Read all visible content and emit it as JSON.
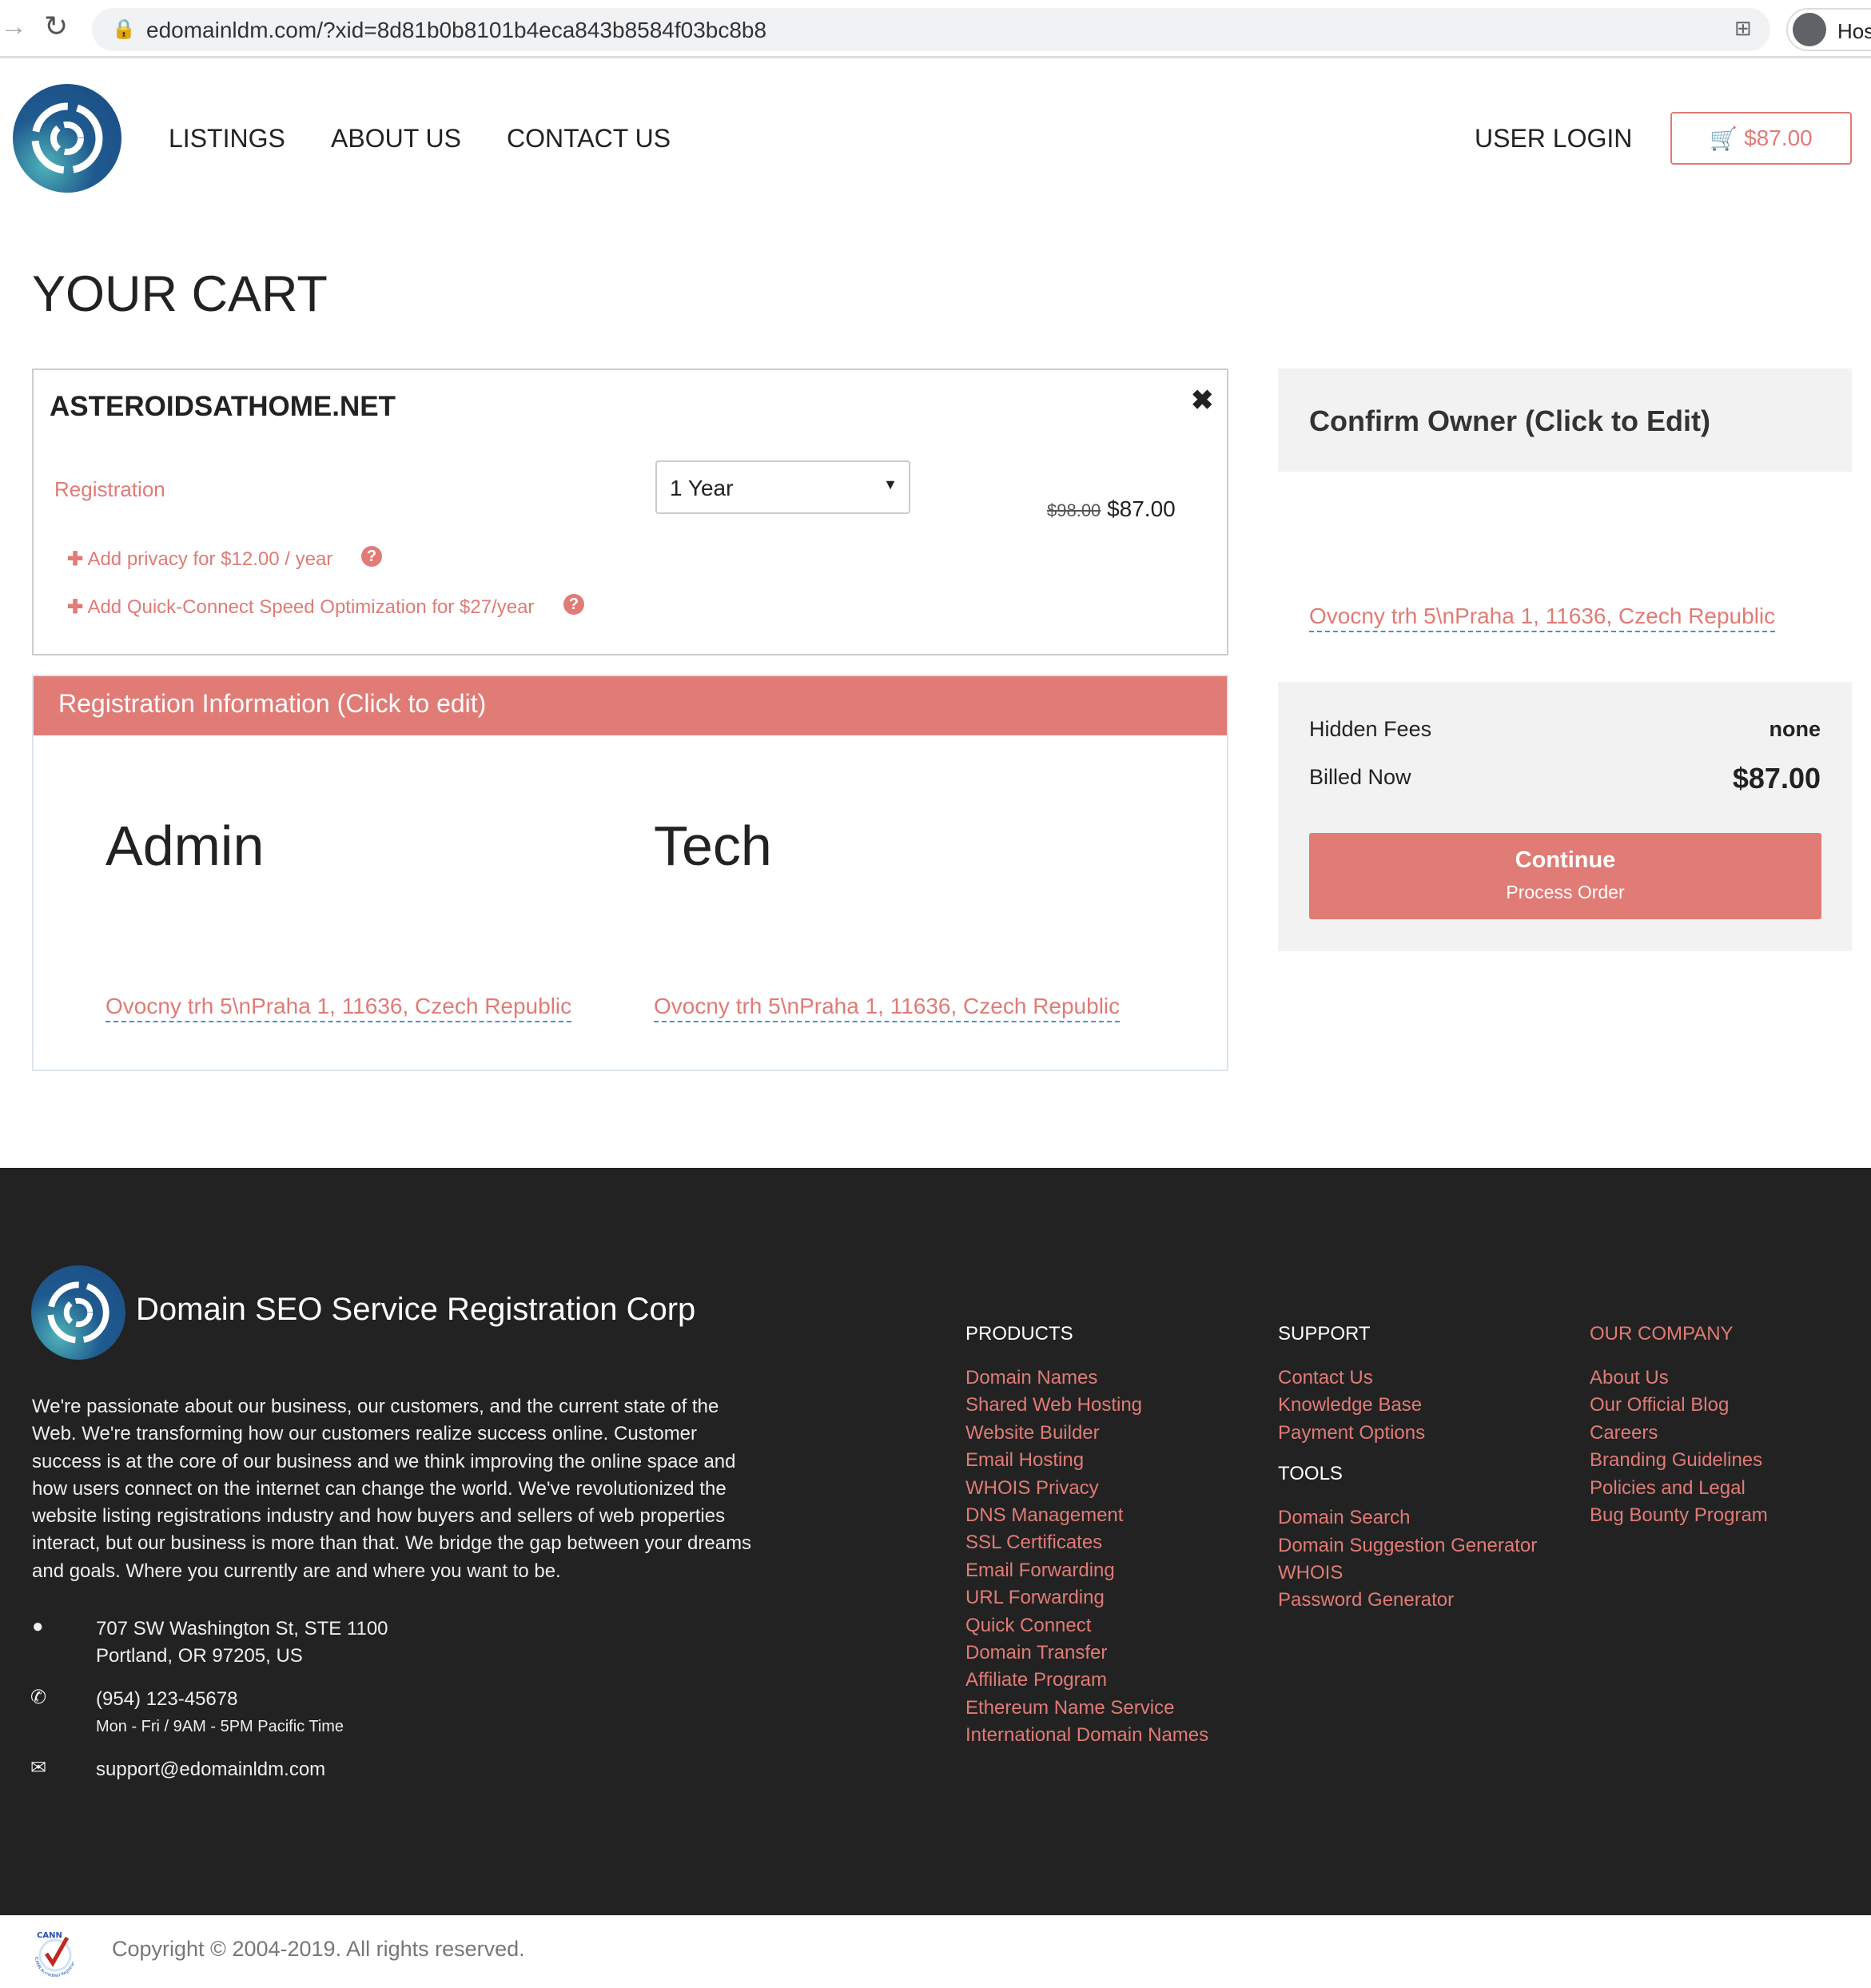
{
  "browser": {
    "url": "edomainldm.com/?xid=8d81b0b8101b4eca843b8584f03bc8b8",
    "profile_label": "Hos"
  },
  "nav": {
    "items": [
      "LISTINGS",
      "ABOUT US",
      "CONTACT US"
    ],
    "login": "USER LOGIN",
    "cart_total": "$87.00"
  },
  "page_title": "YOUR CART",
  "cart": {
    "domain": "ASTEROIDSATHOME.NET",
    "item_label": "Registration",
    "term": "1 Year",
    "old_price": "$98.00",
    "price": "$87.00",
    "addons": [
      "Add privacy for $12.00 / year",
      "Add Quick-Connect Speed Optimization for $27/year"
    ]
  },
  "registration": {
    "header": "Registration Information (Click to edit)",
    "admin_title": "Admin",
    "tech_title": "Tech",
    "admin_address": "Ovocny trh 5\\nPraha 1, 11636, Czech Republic",
    "tech_address": "Ovocny trh 5\\nPraha 1, 11636, Czech Republic"
  },
  "owner": {
    "title": "Confirm Owner (Click to Edit)",
    "address": "Ovocny trh 5\\nPraha 1, 11636, Czech Republic"
  },
  "summary": {
    "hidden_fees_label": "Hidden Fees",
    "hidden_fees_value": "none",
    "billed_label": "Billed Now",
    "billed_value": "$87.00",
    "continue_label": "Continue",
    "continue_sub": "Process Order"
  },
  "footer": {
    "brand": "Domain SEO Service Registration Corp",
    "about": "We're passionate about our business, our customers, and the current state of the Web. We're transforming how our customers realize success online. Customer success is at the core of our business and we think improving the online space and how users connect on the internet can change the world. We've revolutionized the website listing registrations industry and how buyers and sellers of web properties interact, but our business is more than that. We bridge the gap between your dreams and goals. Where you currently are and where you want to be.",
    "address1": "707 SW Washington St, STE 1100",
    "address2": "Portland, OR 97205, US",
    "phone": "(954) 123-45678",
    "hours": "Mon - Fri / 9AM - 5PM Pacific Time",
    "email": "support@edomainldm.com",
    "products": {
      "title": "PRODUCTS",
      "links": [
        "Domain Names",
        "Shared Web Hosting",
        "Website Builder",
        "Email Hosting",
        "WHOIS Privacy",
        "DNS Management",
        "SSL Certificates",
        "Email Forwarding",
        "URL Forwarding",
        "Quick Connect",
        "Domain Transfer",
        "Affiliate Program",
        "Ethereum Name Service",
        "International Domain Names"
      ]
    },
    "support": {
      "title": "SUPPORT",
      "links": [
        "Contact Us",
        "Knowledge Base",
        "Payment Options"
      ]
    },
    "tools": {
      "title": "TOOLS",
      "links": [
        "Domain Search",
        "Domain Suggestion Generator",
        "WHOIS",
        "Password Generator"
      ]
    },
    "company": {
      "title": "OUR COMPANY",
      "links": [
        "About Us",
        "Our Official Blog",
        "Careers",
        "Branding Guidelines",
        "Policies and Legal",
        "Bug Bounty Program"
      ]
    },
    "copyright": "Copyright © 2004-2019. All rights reserved.",
    "icann_logo_text": "ICANN Accredited Registrar"
  },
  "colors": {
    "accent": "#e07b76",
    "footer_bg": "#222222",
    "brand_blue": "#1f5a8f"
  }
}
